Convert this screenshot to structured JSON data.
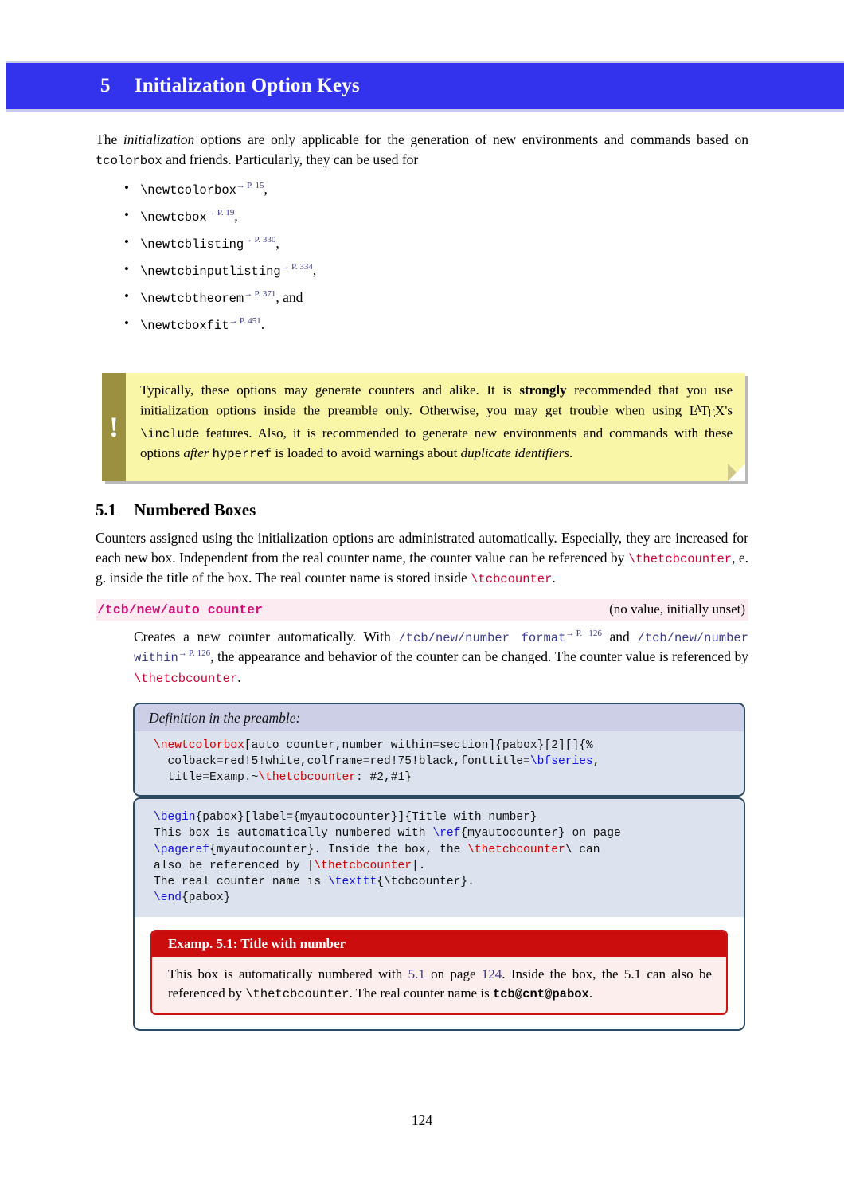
{
  "colors": {
    "section_bar": "#3333ee",
    "warn_background": "#faf6a8",
    "warn_bar": "#9a9040",
    "key_background": "#fcecf2",
    "key_name": "#cc1177",
    "code_background": "#dde3ee",
    "code_title_background": "#cdcfe6",
    "code_frame": "#2b4a63",
    "example_frame": "#cc1111",
    "example_title_background": "#cc0d0d",
    "example_body_background": "#fdeeee",
    "macro_red": "#cc0033",
    "reference_blue": "#3a3a8c"
  },
  "section": {
    "number": "5",
    "title": "Initialization Option Keys"
  },
  "intro": {
    "part1": "The ",
    "emph": "initialization",
    "part2": " options are only applicable for the generation of new environments and commands based on ",
    "code": "tcolorbox",
    "part3": " and friends.  Particularly, they can be used for"
  },
  "bullets": [
    {
      "command": "\\newtcolorbox",
      "page_ref": "P. 15",
      "punct": ","
    },
    {
      "command": "\\newtcbox",
      "page_ref": "P. 19",
      "punct": ","
    },
    {
      "command": "\\newtcblisting",
      "page_ref": "P. 330",
      "punct": ","
    },
    {
      "command": "\\newtcbinputlisting",
      "page_ref": "P. 334",
      "punct": ","
    },
    {
      "command": "\\newtcbtheorem",
      "page_ref": "P. 371",
      "punct": ", and"
    },
    {
      "command": "\\newtcboxfit",
      "page_ref": "P. 451",
      "punct": "."
    }
  ],
  "warning": {
    "icon": "exclamation-mark",
    "t1": "Typically, these options may generate counters and alike.  It is ",
    "strong1": "strongly",
    "t2": " recommended that you use initialization options inside the preamble only.  Otherwise, you may get trouble when using ",
    "latex": "LaTeX",
    "t3": "'s ",
    "code1": "\\include",
    "t4": " features.  Also, it is recommended to generate new environments and commands with these options ",
    "emph1": "after",
    "t5": " ",
    "code2": "hyperref",
    "t6": " is loaded to avoid warnings about ",
    "emph2": "duplicate identifiers",
    "t7": "."
  },
  "subsection": {
    "number": "5.1",
    "title": "Numbered Boxes",
    "para": {
      "t1": "Counters assigned using the initialization options are administrated automatically.  Especially, they are increased for each new box. Independent from the real counter name, the counter value can be referenced by ",
      "macro1": "\\thetcbcounter",
      "t2": ", e. g. inside the title of the box.  The real counter name is stored inside ",
      "macro2": "\\tcbcounter",
      "t3": "."
    }
  },
  "key_entry": {
    "name": "/tcb/new/auto counter",
    "value": "(no value, initially unset)",
    "desc": {
      "t1": "Creates a new counter automatically.   With ",
      "ref1": "/tcb/new/number format",
      "ref1_page": "P. 126",
      "t2": " and ",
      "ref2": "/tcb/new/number within",
      "ref2_page": "P. 126",
      "t3": ", the appearance and behavior of the counter can be changed. The counter value is referenced by ",
      "macro": "\\thetcbcounter",
      "t4": "."
    }
  },
  "code_box_1": {
    "title": "Definition in the preamble:",
    "lines": [
      [
        {
          "t": "\\newtcolorbox",
          "c": "red"
        },
        {
          "t": "[auto counter,number within=section]{pabox}[2][]{%",
          "c": "plain"
        }
      ],
      [
        {
          "t": "  colback=red!5!white,colframe=red!75!black,fonttitle=",
          "c": "plain"
        },
        {
          "t": "\\bfseries",
          "c": "blue"
        },
        {
          "t": ",",
          "c": "plain"
        }
      ],
      [
        {
          "t": "  title=Examp.~",
          "c": "plain"
        },
        {
          "t": "\\thetcbcounter",
          "c": "red"
        },
        {
          "t": ": #2,#1}",
          "c": "plain"
        }
      ]
    ]
  },
  "code_box_2": {
    "lines": [
      [
        {
          "t": "\\begin",
          "c": "blue"
        },
        {
          "t": "{pabox}[label={myautocounter}]{Title with number}",
          "c": "plain"
        }
      ],
      [
        {
          "t": "This box is automatically numbered with ",
          "c": "plain"
        },
        {
          "t": "\\ref",
          "c": "blue"
        },
        {
          "t": "{myautocounter} on page",
          "c": "plain"
        }
      ],
      [
        {
          "t": "\\pageref",
          "c": "blue"
        },
        {
          "t": "{myautocounter}. Inside the box, the ",
          "c": "plain"
        },
        {
          "t": "\\thetcbcounter",
          "c": "red"
        },
        {
          "t": "\\ can",
          "c": "plain"
        }
      ],
      [
        {
          "t": "also be referenced by |",
          "c": "plain"
        },
        {
          "t": "\\thetcbcounter",
          "c": "red"
        },
        {
          "t": "|.",
          "c": "plain"
        }
      ],
      [
        {
          "t": "The real counter name is ",
          "c": "plain"
        },
        {
          "t": "\\texttt",
          "c": "blue"
        },
        {
          "t": "{\\tcbcounter}.",
          "c": "plain"
        }
      ],
      [
        {
          "t": "\\end",
          "c": "blue"
        },
        {
          "t": "{pabox}",
          "c": "plain"
        }
      ]
    ]
  },
  "example_box": {
    "title": "Examp. 5.1: Title with number",
    "body": {
      "t1": "This box is automatically numbered with ",
      "ref_num": "5.1",
      "t2": " on page ",
      "ref_page": "124",
      "t3": ".  Inside the box, the 5.1 can also be referenced by ",
      "macro": "\\thetcbcounter",
      "t4": ". The real counter name is ",
      "counter_name": "tcb@cnt@pabox",
      "t5": "."
    }
  },
  "page_number": "124"
}
